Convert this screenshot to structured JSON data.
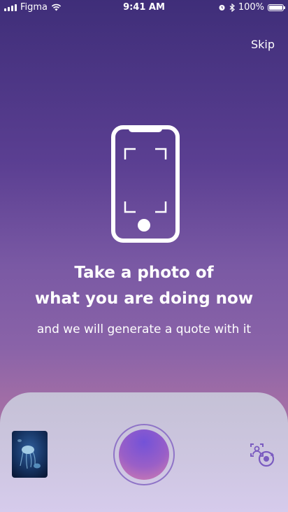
{
  "status_bar": {
    "carrier": "Figma",
    "time": "9:41 AM",
    "battery": "100%",
    "signal_bars": 4
  },
  "header": {
    "skip_label": "Skip"
  },
  "onboarding": {
    "title_line1": "Take a photo of",
    "title_line2": "what you are doing now",
    "subtitle": "and we will generate a quote with it"
  },
  "icons": {
    "phone": "phone-frame-icon",
    "camera_flip": "camera-flip-icon",
    "wifi": "wifi-icon",
    "alarm": "alarm-icon",
    "bluetooth": "bluetooth-icon"
  },
  "colors": {
    "background_top": "#3f2e79",
    "background_bottom": "#b98aa8",
    "panel": "#cdc6e0",
    "shutter_inner": "#7352d8",
    "accent_icon": "#7a5bc0"
  }
}
